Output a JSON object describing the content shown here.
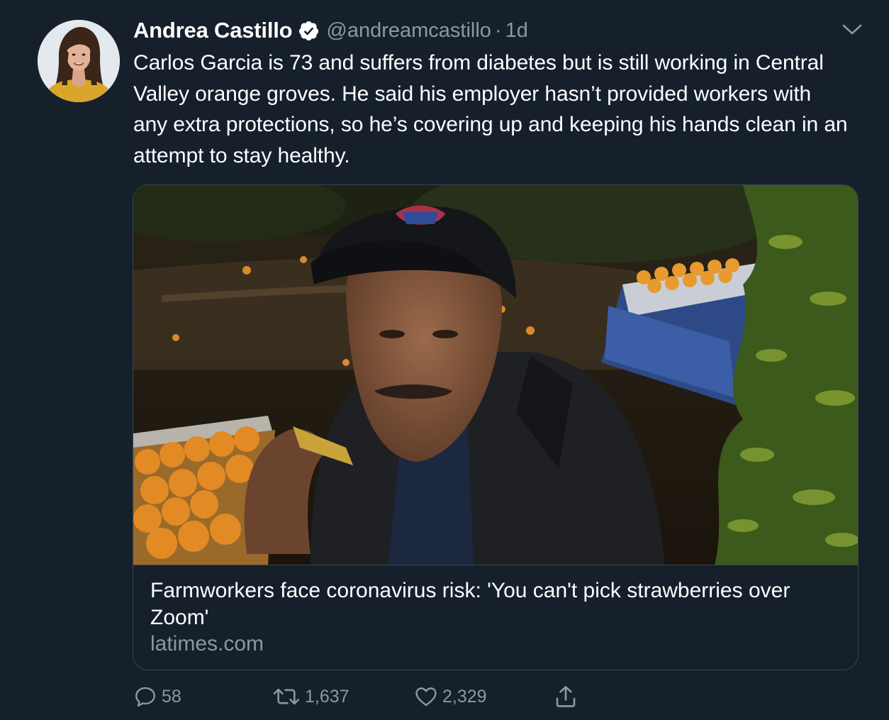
{
  "author": {
    "name": "Andrea Castillo",
    "handle": "@andreamcastillo",
    "separator": "·",
    "time": "1d",
    "verified": true
  },
  "tweet": {
    "text": "Carlos Garcia is 73 and suffers from diabetes but is still working in Central Valley orange groves. He said his employer hasn’t provided workers with any extra protections, so he’s covering up and keeping his hands clean in an attempt to stay healthy."
  },
  "card": {
    "title": "Farmworkers face coronavirus risk: 'You can't pick strawberries over Zoom'",
    "domain": "latimes.com"
  },
  "actions": {
    "replies": "58",
    "retweets": "1,637",
    "likes": "2,329"
  },
  "icons": {
    "verified": "verified-badge-icon",
    "chevron": "chevron-down-icon",
    "reply": "reply-icon",
    "retweet": "retweet-icon",
    "like": "heart-icon",
    "share": "share-icon"
  },
  "colors": {
    "background": "#15202b",
    "secondary_text": "#8899a6",
    "border": "#38444d",
    "primary_text": "#ffffff"
  }
}
